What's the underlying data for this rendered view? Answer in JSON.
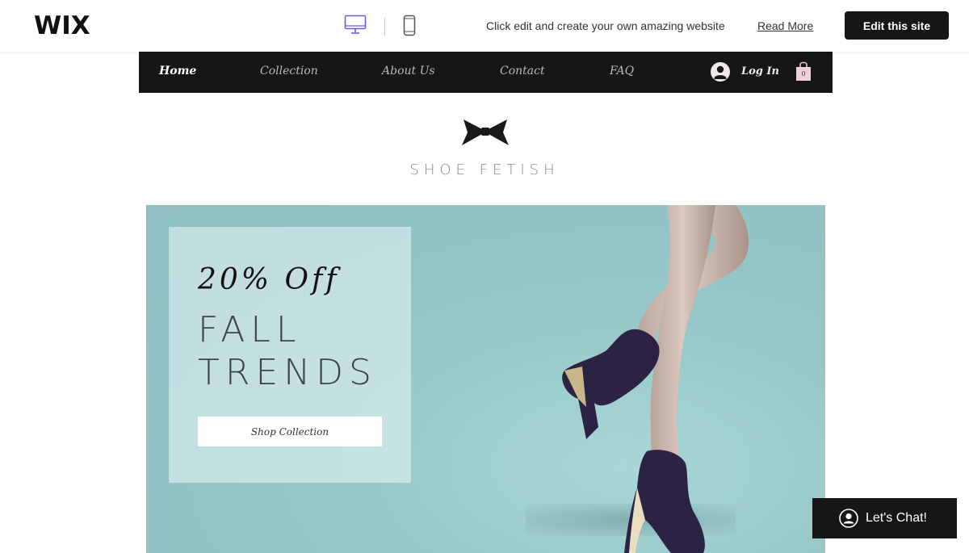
{
  "wix_bar": {
    "logo": "WIX",
    "desktop_view": "desktop-icon",
    "mobile_view": "mobile-icon",
    "promo_text": "Click edit and create your own amazing website",
    "read_more": "Read More",
    "edit_button": "Edit this site"
  },
  "nav": {
    "items": [
      "Home",
      "Collection",
      "About Us",
      "Contact",
      "FAQ"
    ],
    "active": "Home",
    "login": "Log In",
    "cart_count": "0"
  },
  "brand": {
    "name": "SHOE FETISH"
  },
  "hero": {
    "offer": "20% Off",
    "headline_line1": "FALL",
    "headline_line2": "TRENDS",
    "cta": "Shop Collection"
  },
  "chat": {
    "label": "Let's Chat!"
  },
  "colors": {
    "accent_dark": "#161616",
    "hero_bg": "#97c7c8",
    "device_active": "#6b5bd6"
  }
}
